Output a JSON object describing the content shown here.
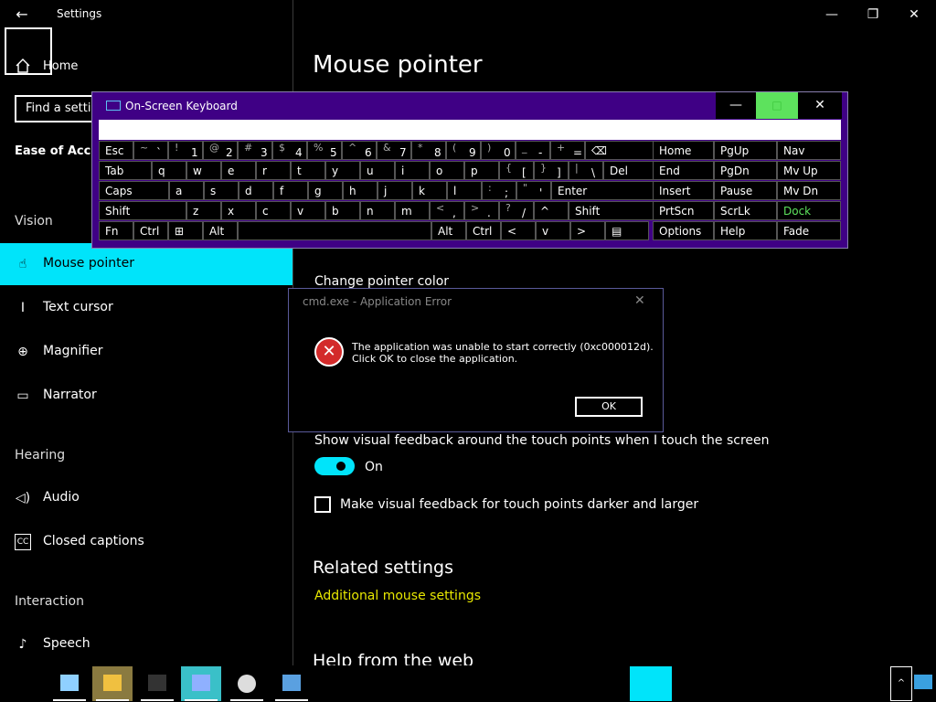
{
  "window": {
    "title": "Settings",
    "back": "←",
    "min": "—",
    "max": "❐",
    "close": "✕"
  },
  "sidebar": {
    "home": "Home",
    "search_placeholder": "Find a setting",
    "category": "Ease of Access",
    "sections": {
      "vision": "Vision",
      "hearing": "Hearing",
      "interaction": "Interaction"
    },
    "items": [
      {
        "label": "Mouse pointer",
        "icon": "mouse-pointer-icon",
        "glyph": "☝"
      },
      {
        "label": "Text cursor",
        "icon": "text-cursor-icon",
        "glyph": "I"
      },
      {
        "label": "Magnifier",
        "icon": "magnifier-icon",
        "glyph": "⊕"
      },
      {
        "label": "Narrator",
        "icon": "narrator-icon",
        "glyph": "▭"
      },
      {
        "label": "Audio",
        "icon": "audio-icon",
        "glyph": "◁)"
      },
      {
        "label": "Closed captions",
        "icon": "closed-captions-icon",
        "glyph": "CC"
      },
      {
        "label": "Speech",
        "icon": "microphone-icon",
        "glyph": "♪"
      }
    ]
  },
  "main": {
    "title": "Mouse pointer",
    "pointer_color": "Change pointer color",
    "touch_feedback": "Show visual feedback around the touch points when I touch the screen",
    "toggle_state": "On",
    "checkbox_label": "Make visual feedback for touch points darker and larger",
    "related": "Related settings",
    "additional_mouse": "Additional mouse settings",
    "help_web": "Help from the web"
  },
  "osk": {
    "title": "On-Screen Keyboard",
    "min": "—",
    "max": "□",
    "close": "✕",
    "rows": [
      [
        {
          "p": "Esc"
        },
        {
          "s": "~",
          "n": "`"
        },
        {
          "s": "!",
          "n": "1"
        },
        {
          "s": "@",
          "n": "2"
        },
        {
          "s": "#",
          "n": "3"
        },
        {
          "s": "$",
          "n": "4"
        },
        {
          "s": "%",
          "n": "5"
        },
        {
          "s": "^",
          "n": "6"
        },
        {
          "s": "&",
          "n": "7"
        },
        {
          "s": "*",
          "n": "8"
        },
        {
          "s": "(",
          "n": "9"
        },
        {
          "s": ")",
          "n": "0"
        },
        {
          "s": "_",
          "n": "-"
        },
        {
          "s": "+",
          "n": "="
        },
        {
          "p": "⌫"
        }
      ],
      [
        {
          "p": "Tab"
        },
        {
          "p": "q"
        },
        {
          "p": "w"
        },
        {
          "p": "e"
        },
        {
          "p": "r"
        },
        {
          "p": "t"
        },
        {
          "p": "y"
        },
        {
          "p": "u"
        },
        {
          "p": "i"
        },
        {
          "p": "o"
        },
        {
          "p": "p"
        },
        {
          "s": "{",
          "n": "["
        },
        {
          "s": "}",
          "n": "]"
        },
        {
          "s": "|",
          "n": "\\"
        },
        {
          "p": "Del"
        }
      ],
      [
        {
          "p": "Caps"
        },
        {
          "p": "a"
        },
        {
          "p": "s"
        },
        {
          "p": "d"
        },
        {
          "p": "f"
        },
        {
          "p": "g"
        },
        {
          "p": "h"
        },
        {
          "p": "j"
        },
        {
          "p": "k"
        },
        {
          "p": "l"
        },
        {
          "s": ":",
          "n": ";"
        },
        {
          "s": "\"",
          "n": "'"
        },
        {
          "p": "Enter"
        }
      ],
      [
        {
          "p": "Shift"
        },
        {
          "p": "z"
        },
        {
          "p": "x"
        },
        {
          "p": "c"
        },
        {
          "p": "v"
        },
        {
          "p": "b"
        },
        {
          "p": "n"
        },
        {
          "p": "m"
        },
        {
          "s": "<",
          "n": ","
        },
        {
          "s": ">",
          "n": "."
        },
        {
          "s": "?",
          "n": "/"
        },
        {
          "p": "^"
        },
        {
          "p": "Shift"
        }
      ],
      [
        {
          "p": "Fn"
        },
        {
          "p": "Ctrl"
        },
        {
          "p": "⊞"
        },
        {
          "p": "Alt"
        },
        {
          "p": ""
        },
        {
          "p": "Alt"
        },
        {
          "p": "Ctrl"
        },
        {
          "p": "<"
        },
        {
          "p": "v"
        },
        {
          "p": ">"
        },
        {
          "p": "▤"
        }
      ]
    ],
    "nav": [
      [
        "Home",
        "PgUp",
        "Nav"
      ],
      [
        "End",
        "PgDn",
        "Mv Up"
      ],
      [
        "Insert",
        "Pause",
        "Mv Dn"
      ],
      [
        "PrtScn",
        "ScrLk",
        "Dock"
      ],
      [
        "Options",
        "Help",
        "Fade"
      ]
    ],
    "dock_color": "#5de25d"
  },
  "dialog": {
    "title": "cmd.exe - Application Error",
    "close": "✕",
    "icon": "✕",
    "line1": "The application was unable to start correctly (0xc000012d).",
    "line2": "Click OK to close the application.",
    "ok": "OK"
  },
  "taskbar": {
    "apps": [
      {
        "name": "notepad-taskbar-icon",
        "color": "#8fd0ff"
      },
      {
        "name": "file-explorer-taskbar-icon",
        "color": "#f0c040"
      },
      {
        "name": "cmd-taskbar-icon",
        "color": "#333333"
      },
      {
        "name": "osk-taskbar-icon",
        "color": "#8fb0ff"
      },
      {
        "name": "clock-taskbar-icon",
        "color": "#dddddd"
      },
      {
        "name": "window-taskbar-icon",
        "color": "#5aa0e0"
      }
    ],
    "tray_arrow": "^"
  }
}
